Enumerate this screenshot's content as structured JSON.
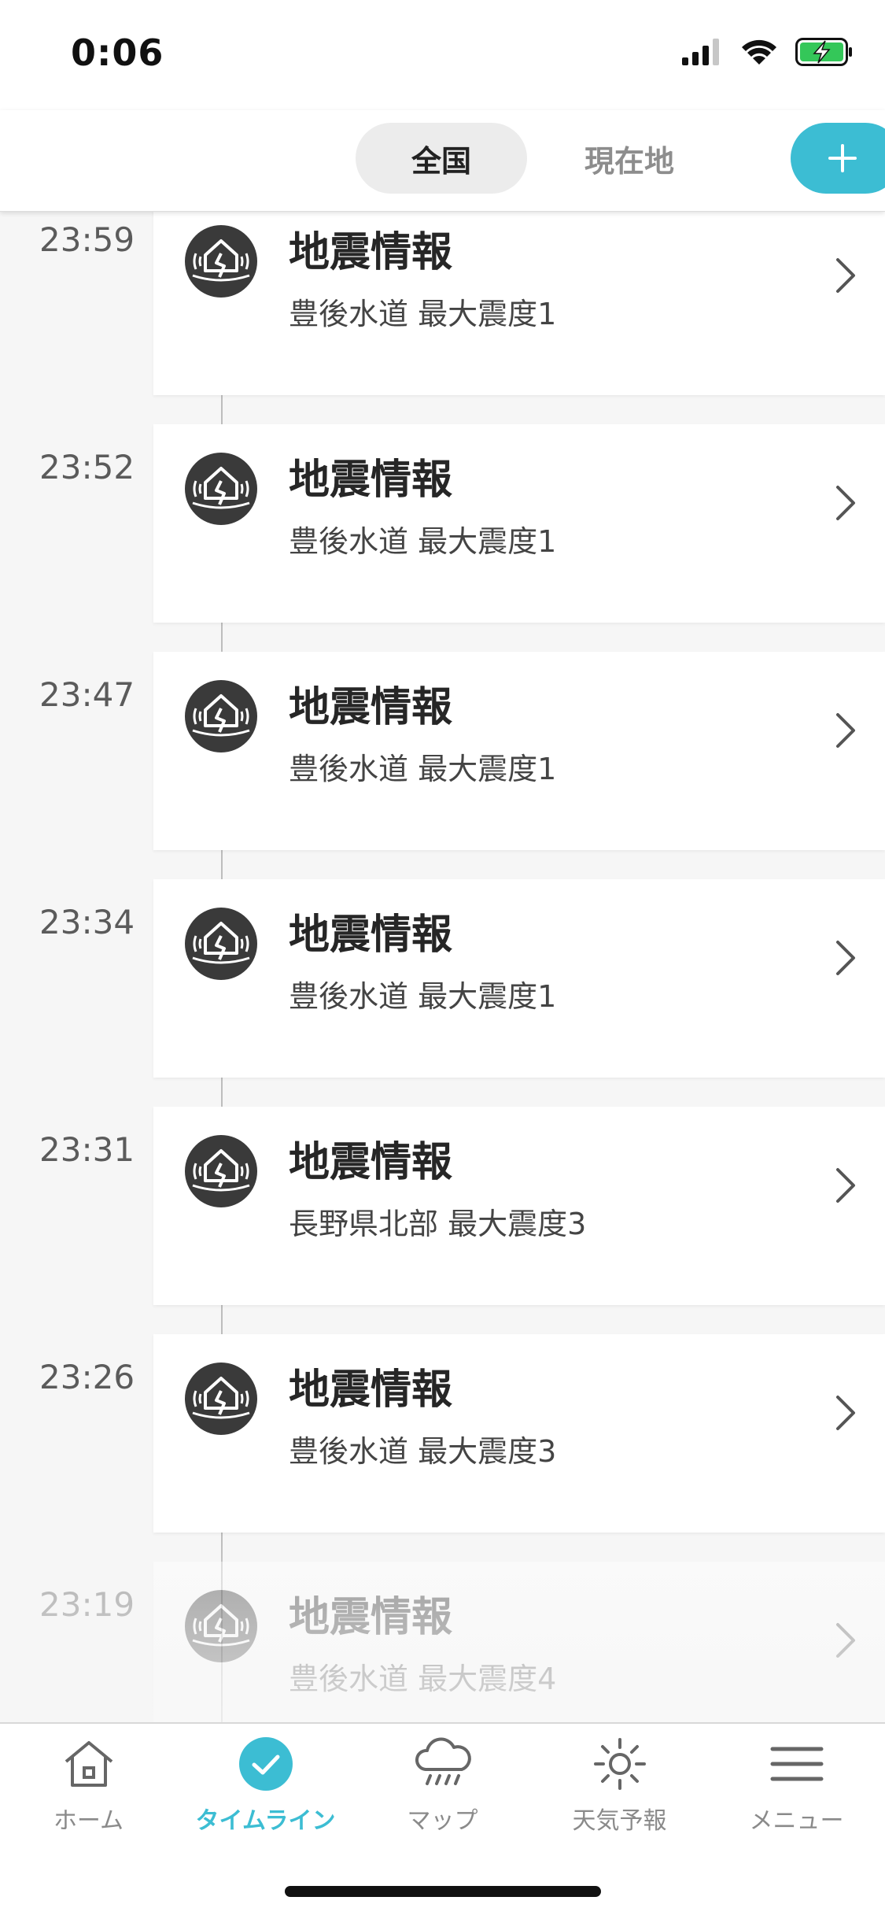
{
  "status_bar": {
    "time": "0:06"
  },
  "header": {
    "tabs": [
      {
        "label": "全国",
        "active": true
      },
      {
        "label": "現在地",
        "active": false
      }
    ],
    "add_button_icon": "plus-icon"
  },
  "timeline": {
    "items": [
      {
        "time": "23:59",
        "title": "地震情報",
        "detail": "豊後水道 最大震度1"
      },
      {
        "time": "23:52",
        "title": "地震情報",
        "detail": "豊後水道 最大震度1"
      },
      {
        "time": "23:47",
        "title": "地震情報",
        "detail": "豊後水道 最大震度1"
      },
      {
        "time": "23:34",
        "title": "地震情報",
        "detail": "豊後水道 最大震度1"
      },
      {
        "time": "23:31",
        "title": "地震情報",
        "detail": "長野県北部 最大震度3"
      },
      {
        "time": "23:26",
        "title": "地震情報",
        "detail": "豊後水道 最大震度3"
      },
      {
        "time": "23:19",
        "title": "地震情報",
        "detail": "豊後水道 最大震度4"
      }
    ]
  },
  "bottom_nav": {
    "items": [
      {
        "label": "ホーム",
        "icon": "home-icon"
      },
      {
        "label": "タイムライン",
        "icon": "check-circle-icon",
        "active": true
      },
      {
        "label": "マップ",
        "icon": "rain-cloud-icon"
      },
      {
        "label": "天気予報",
        "icon": "sun-icon"
      },
      {
        "label": "メニュー",
        "icon": "menu-icon"
      }
    ]
  },
  "colors": {
    "accent": "#3cbdd3",
    "icon_dark": "#3a3a3a"
  }
}
